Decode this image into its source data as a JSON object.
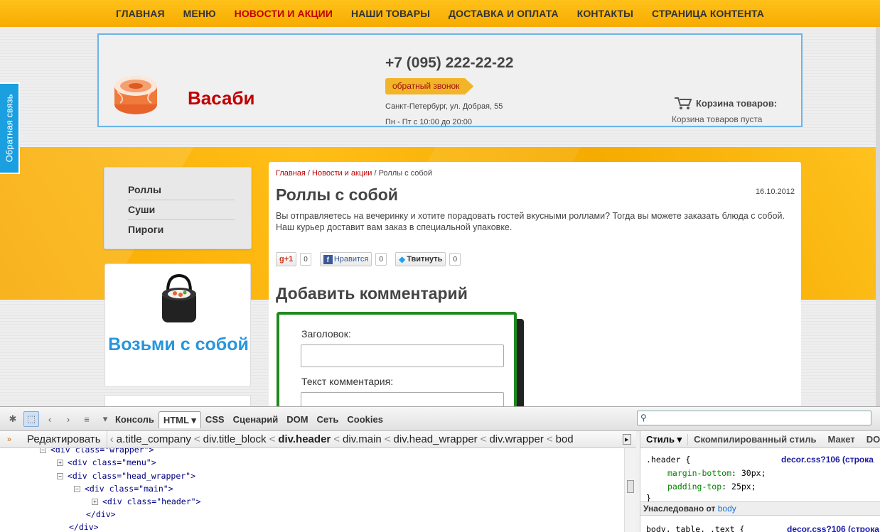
{
  "nav": {
    "items": [
      "ГЛАВНАЯ",
      "МЕНЮ",
      "НОВОСТИ И АКЦИИ",
      "НАШИ ТОВАРЫ",
      "ДОСТАВКА И ОПЛАТА",
      "КОНТАКТЫ",
      "СТРАНИЦА КОНТЕНТА"
    ],
    "active_index": 2
  },
  "header": {
    "company": "Васаби",
    "phone": "+7 (095) 222-22-22",
    "callback": "обратный звонок",
    "address": "Санкт-Петербург, ул. Добрая, 55",
    "hours": "Пн - Пт с 10:00 до 20:00",
    "cart_title": "Корзина товаров:",
    "cart_empty": "Корзина товаров пуста"
  },
  "feedback_tab": "Обратная связь",
  "sidebar": {
    "items": [
      "Роллы",
      "Суши",
      "Пироги"
    ],
    "promo": "Возьми с собой"
  },
  "article": {
    "breadcrumb": {
      "home": "Главная",
      "section": "Новости и акции",
      "current": "Роллы с собой",
      "sep": " / "
    },
    "title": "Роллы с собой",
    "date": "16.10.2012",
    "text": "Вы отправляетесь на вечеринку и хотите порадовать гостей вкусными роллами? Тогда вы можете заказать блюда с собой. Наш курьер доставит вам заказ в специальной упаковке.",
    "social": {
      "gplus": "+1",
      "gplus_count": "0",
      "fb": "Нравится",
      "fb_count": "0",
      "tw": "Твитнуть",
      "tw_count": "0"
    },
    "comment_heading": "Добавить комментарий",
    "form": {
      "title_label": "Заголовок:",
      "text_label": "Текст комментария:"
    }
  },
  "devtools": {
    "tabs": [
      "Консоль",
      "HTML",
      "CSS",
      "Сценарий",
      "DOM",
      "Сеть",
      "Cookies"
    ],
    "active_tab": "HTML",
    "edit_button": "Редактировать",
    "breadcrumbs": [
      "a.title_company",
      "div.title_block",
      "div.header",
      "div.main",
      "div.head_wrapper",
      "div.wrapper",
      "bod"
    ],
    "tree": [
      {
        "indent": 0,
        "text": "<div class=\"wrapper\">"
      },
      {
        "indent": 1,
        "text": "<div class=\"menu\">"
      },
      {
        "indent": 1,
        "text": "<div class=\"head_wrapper\">"
      },
      {
        "indent": 2,
        "text": "<div class=\"main\">"
      },
      {
        "indent": 3,
        "text": "<div class=\"header\">"
      },
      {
        "indent": 2,
        "text": "</div>"
      },
      {
        "indent": 1,
        "text": "</div>"
      }
    ],
    "side_tabs": [
      "Стиль",
      "Скомпилированный стиль",
      "Макет",
      "DO"
    ],
    "css": {
      "selector": ".header {",
      "source": "decor.css?106 (строка",
      "props": [
        {
          "name": "margin-bottom",
          "value": "30px;"
        },
        {
          "name": "padding-top",
          "value": "25px;"
        }
      ],
      "close": "}",
      "inherited_label": "Унаследовано от",
      "inherited_from": "body",
      "next_selector": "body, table, .text {",
      "next_source": "decor.css?106 (строка"
    }
  }
}
